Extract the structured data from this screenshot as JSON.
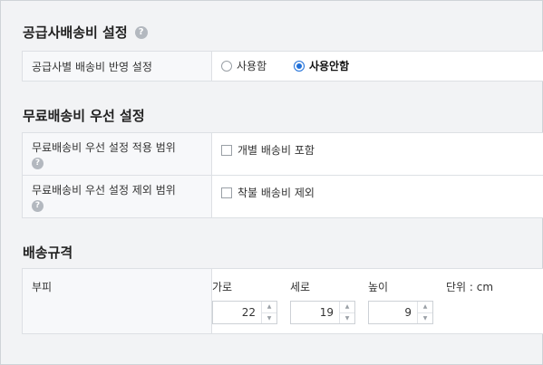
{
  "supplier_shipping": {
    "title": "공급사배송비 설정",
    "row_label": "공급사별 배송비 반영 설정",
    "options": [
      "사용함",
      "사용안함"
    ],
    "selected": "사용안함"
  },
  "free_shipping": {
    "title": "무료배송비 우선 설정",
    "rows": [
      {
        "label": "무료배송비 우선 설정 적용 범위",
        "checkbox_label": "개별 배송비 포함"
      },
      {
        "label": "무료배송비 우선 설정 제외 범위",
        "checkbox_label": "착불 배송비 제외"
      }
    ]
  },
  "shipping_spec": {
    "title": "배송규격",
    "row_label": "부피",
    "width_label": "가로",
    "length_label": "세로",
    "height_label": "높이",
    "unit_label": "단위 : cm",
    "width_value": "22",
    "length_value": "19",
    "height_value": "9"
  },
  "icons": {
    "help": "?",
    "up": "▲",
    "down": "▼"
  },
  "colors": {
    "accent": "#1e6fd9"
  }
}
